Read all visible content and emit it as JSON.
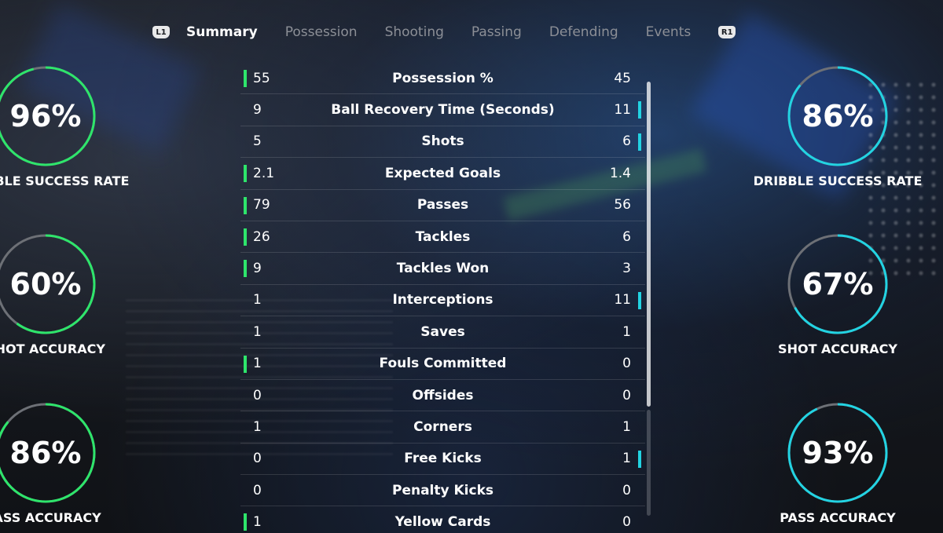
{
  "tabs": {
    "left_shoulder": "L1",
    "right_shoulder": "R1",
    "items": [
      "Summary",
      "Possession",
      "Shooting",
      "Passing",
      "Defending",
      "Events"
    ],
    "active": "Summary"
  },
  "stats": [
    {
      "label": "Possession %",
      "home": "55",
      "away": "45",
      "leader": "home"
    },
    {
      "label": "Ball Recovery Time (Seconds)",
      "home": "9",
      "away": "11",
      "leader": "away"
    },
    {
      "label": "Shots",
      "home": "5",
      "away": "6",
      "leader": "away"
    },
    {
      "label": "Expected Goals",
      "home": "2.1",
      "away": "1.4",
      "leader": "home"
    },
    {
      "label": "Passes",
      "home": "79",
      "away": "56",
      "leader": "home"
    },
    {
      "label": "Tackles",
      "home": "26",
      "away": "6",
      "leader": "home"
    },
    {
      "label": "Tackles Won",
      "home": "9",
      "away": "3",
      "leader": "home"
    },
    {
      "label": "Interceptions",
      "home": "1",
      "away": "11",
      "leader": "away"
    },
    {
      "label": "Saves",
      "home": "1",
      "away": "1",
      "leader": "none"
    },
    {
      "label": "Fouls Committed",
      "home": "1",
      "away": "0",
      "leader": "home"
    },
    {
      "label": "Offsides",
      "home": "0",
      "away": "0",
      "leader": "none"
    },
    {
      "label": "Corners",
      "home": "1",
      "away": "1",
      "leader": "none"
    },
    {
      "label": "Free Kicks",
      "home": "0",
      "away": "1",
      "leader": "away"
    },
    {
      "label": "Penalty Kicks",
      "home": "0",
      "away": "0",
      "leader": "none"
    },
    {
      "label": "Yellow Cards",
      "home": "1",
      "away": "0",
      "leader": "home"
    }
  ],
  "home_gauges": [
    {
      "value": "96%",
      "fraction": 0.96,
      "label": "DRIBBLE SUCCESS RATE"
    },
    {
      "value": "60%",
      "fraction": 0.6,
      "label": "SHOT ACCURACY"
    },
    {
      "value": "86%",
      "fraction": 0.86,
      "label": "PASS ACCURACY"
    }
  ],
  "away_gauges": [
    {
      "value": "86%",
      "fraction": 0.86,
      "label": "DRIBBLE SUCCESS RATE"
    },
    {
      "value": "67%",
      "fraction": 0.67,
      "label": "SHOT ACCURACY"
    },
    {
      "value": "93%",
      "fraction": 0.93,
      "label": "PASS ACCURACY"
    }
  ],
  "colors": {
    "home": "#2ee56b",
    "away": "#22d3e2",
    "ring_track": "#6d7076"
  }
}
